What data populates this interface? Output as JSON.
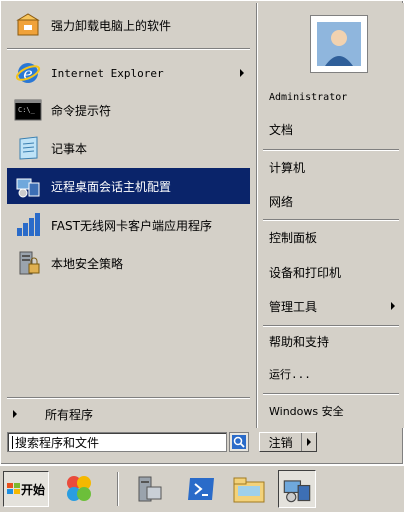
{
  "left_items": [
    {
      "label": "强力卸载电脑上的软件",
      "icon": "uninstall-box-icon",
      "selected": false,
      "arrow": false
    },
    {
      "label": "Internet Explorer",
      "icon": "internet-explorer-icon",
      "selected": false,
      "arrow": true
    },
    {
      "label": "命令提示符",
      "icon": "command-prompt-icon",
      "selected": false,
      "arrow": false
    },
    {
      "label": "记事本",
      "icon": "notepad-icon",
      "selected": false,
      "arrow": false
    },
    {
      "label": "远程桌面会话主机配置",
      "icon": "remote-desktop-config-icon",
      "selected": true,
      "arrow": false
    },
    {
      "label": "FAST无线网卡客户端应用程序",
      "icon": "wireless-bars-icon",
      "selected": false,
      "arrow": false
    },
    {
      "label": "本地安全策略",
      "icon": "security-policy-icon",
      "selected": false,
      "arrow": false
    }
  ],
  "all_programs": "所有程序",
  "search": {
    "placeholder": "搜索程序和文件",
    "value": ""
  },
  "right_items": [
    {
      "label": "Administrator",
      "arrow": false
    },
    {
      "label": "文档",
      "arrow": false
    },
    {
      "label": "计算机",
      "arrow": false
    },
    {
      "label": "网络",
      "arrow": false
    },
    {
      "label": "控制面板",
      "arrow": false
    },
    {
      "label": "设备和打印机",
      "arrow": false
    },
    {
      "label": "管理工具",
      "arrow": true
    },
    {
      "label": "帮助和支持",
      "arrow": false
    },
    {
      "label": "运行...",
      "arrow": false
    },
    {
      "label": "Windows 安全",
      "arrow": false
    }
  ],
  "shutdown_label": "注销",
  "start_label": "开始",
  "taskbar_icons": [
    "colorful-app-icon",
    "server-manager-icon",
    "powershell-icon",
    "explorer-folder-icon",
    "remote-desktop-config-icon"
  ],
  "colors": {
    "selection": "#0a246a",
    "face": "#d4d0c8"
  }
}
